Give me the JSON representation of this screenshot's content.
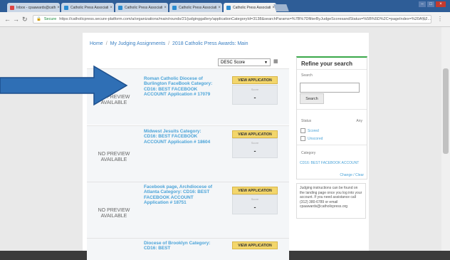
{
  "browser": {
    "tabs": [
      {
        "label": "Inbox - cpaawards@cath"
      },
      {
        "label": "Catholic Press Associati"
      },
      {
        "label": "Catholic Press Associati"
      },
      {
        "label": "Catholic Press Associati"
      },
      {
        "label": "Catholic Press Associati"
      }
    ],
    "url_secure": "Secure",
    "url": "https://catholicpress.secure-platform.com/a/organizations/main/rounds/21/judginggallery/applicationCategoryId=3138&searchParams=%7B%7DfilterByJudgeScoresandStatus=%5B%5D%2C=pageIndex=%20A%2..."
  },
  "breadcrumb": {
    "home": "Home",
    "sep": "/",
    "assignments": "My Judging Assignments",
    "round": "2018 Catholic Press Awards: Main"
  },
  "sort": {
    "selected": "DESC Score"
  },
  "applications": [
    {
      "title": "Roman Catholic Diocese of Burlington FaceBook Category: CD16: BEST FACEBOOK ACCOUNT Application # 17079",
      "preview": "NO PREVIEW AVAILABLE",
      "button": "VIEW APPLICATION",
      "score_label": "Score",
      "score": "-"
    },
    {
      "title": "Midwest Jesuits Category: CD16: BEST FACEBOOK ACCOUNT Application # 18604",
      "preview": "NO PREVIEW AVAILABLE",
      "button": "VIEW APPLICATION",
      "score_label": "Score",
      "score": "-"
    },
    {
      "title": "Facebook page, Archdiocese of Atlanta Category: CD16: BEST FACEBOOK ACCOUNT Application # 18751",
      "preview": "NO PREVIEW AVAILABLE",
      "button": "VIEW APPLICATION",
      "score_label": "Score",
      "score": "-"
    },
    {
      "title": "Diocese of Brooklyn Category: CD16: BEST",
      "preview": "",
      "button": "VIEW APPLICATION",
      "score_label": "",
      "score": ""
    }
  ],
  "sidebar": {
    "title": "Refine your search",
    "search_label": "Search",
    "search_button": "Search",
    "status_label": "Status",
    "status_any": "Any",
    "status_scored": "Scored",
    "status_unscored": "Unscored",
    "category_label": "Category",
    "category_value": "CD16: BEST FACEBOOK ACCOUNT",
    "change_clear": "Change / Clear"
  },
  "instructions": "Judging instructions can be found on the landing page once you log into your account. If you need assistance call (312) 380-6789 or email cpaawards@catholicpress.org",
  "colors": {
    "accent": "#4aa3d8",
    "button": "#f3d66b",
    "green": "#3aa84a",
    "arrow": "#2f6fb5"
  }
}
